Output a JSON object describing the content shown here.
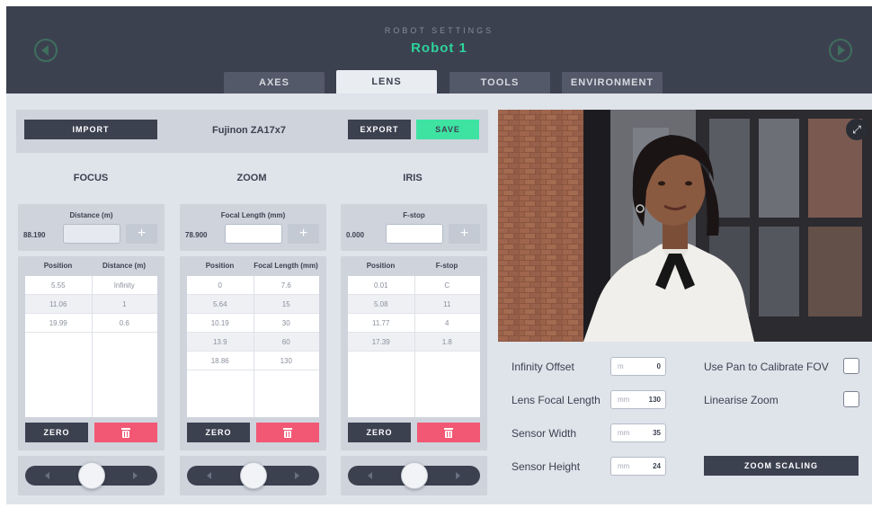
{
  "header": {
    "subtitle": "ROBOT SETTINGS",
    "title": "Robot 1"
  },
  "tabs": [
    {
      "label": "AXES"
    },
    {
      "label": "LENS"
    },
    {
      "label": "TOOLS"
    },
    {
      "label": "ENVIRONMENT"
    }
  ],
  "toolbar": {
    "import_label": "IMPORT",
    "lens_name": "Fujinon ZA17x7",
    "export_label": "EXPORT",
    "save_label": "SAVE"
  },
  "focus": {
    "title": "FOCUS",
    "field_label": "Distance (m)",
    "value": "88.190",
    "col1": "Position",
    "col2": "Distance (m)",
    "rows": [
      [
        "5.55",
        "Infinity"
      ],
      [
        "11.06",
        "1"
      ],
      [
        "19.99",
        "0.6"
      ]
    ],
    "zero_label": "ZERO",
    "slider_level": 0.5
  },
  "zoom": {
    "title": "ZOOM",
    "field_label": "Focal Length (mm)",
    "value": "78.900",
    "col1": "Position",
    "col2": "Focal Length (mm)",
    "rows": [
      [
        "0",
        "7.6"
      ],
      [
        "5.64",
        "15"
      ],
      [
        "10.19",
        "30"
      ],
      [
        "13.9",
        "60"
      ],
      [
        "18.86",
        "130"
      ]
    ],
    "zero_label": "ZERO",
    "slider_level": 0.5
  },
  "iris": {
    "title": "IRIS",
    "field_label": "F-stop",
    "value": "0.000",
    "col1": "Position",
    "col2": "F-stop",
    "rows": [
      [
        "0.01",
        "C"
      ],
      [
        "5.08",
        "11"
      ],
      [
        "11.77",
        "4"
      ],
      [
        "17.39",
        "1.8"
      ]
    ],
    "zero_label": "ZERO",
    "slider_level": 0.5
  },
  "settings": {
    "infinity_offset_label": "Infinity Offset",
    "infinity_offset_unit": "m",
    "infinity_offset_value": "0",
    "lens_focal_length_label": "Lens Focal Length",
    "lens_focal_length_unit": "mm",
    "lens_focal_length_value": "130",
    "sensor_width_label": "Sensor Width",
    "sensor_width_unit": "mm",
    "sensor_width_value": "35",
    "sensor_height_label": "Sensor Height",
    "sensor_height_unit": "mm",
    "sensor_height_value": "24",
    "use_pan_label": "Use Pan to Calibrate FOV",
    "use_pan_checked": false,
    "linearise_zoom_label": "Linearise Zoom",
    "linearise_zoom_checked": false,
    "zoom_scaling_label": "ZOOM SCALING"
  },
  "colors": {
    "accent": "#2dd39a",
    "save": "#3ee3a2",
    "delete": "#f25874",
    "header_bg": "#3c4150"
  },
  "icons": {
    "prev": "chevron-left-icon",
    "next": "chevron-right-icon",
    "delete": "trash-icon",
    "expand": "expand-icon",
    "plus": "plus-icon"
  }
}
